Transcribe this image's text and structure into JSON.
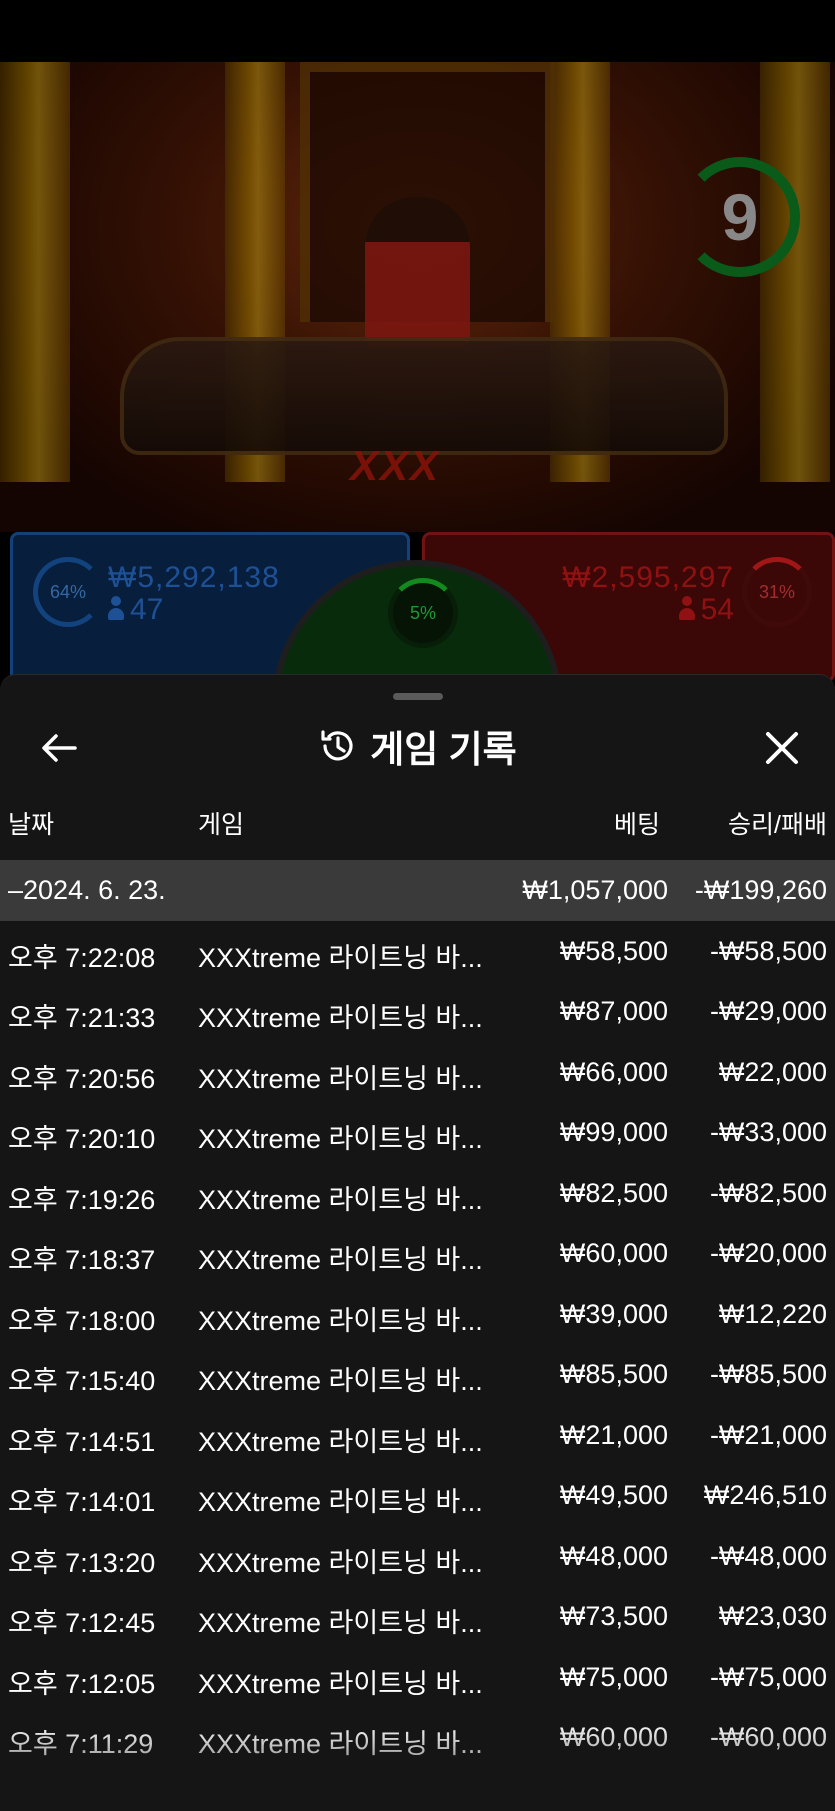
{
  "scene": {
    "timer_value": "9",
    "table_logo": "XXX",
    "player_bet": {
      "percent": "64%",
      "amount": "₩5,292,138",
      "players": "47"
    },
    "banker_bet": {
      "percent": "31%",
      "amount": "₩2,595,297",
      "players": "54"
    },
    "tie_bet": {
      "percent": "5%"
    }
  },
  "colors": {
    "player_blue": "#1e5aa8",
    "banker_red": "#a01a1a",
    "tie_green": "#0c3d10",
    "sheet_bg": "#151515",
    "day_row_bg": "#3a3a3a"
  },
  "history": {
    "title": "게임 기록",
    "icons": {
      "back": "arrow-left-icon",
      "history": "history-clock-icon",
      "close": "close-icon"
    },
    "columns": {
      "date": "날짜",
      "game": "게임",
      "bet": "베팅",
      "result": "승리/패배"
    },
    "day_summary": {
      "date": "–2024. 6. 23.",
      "bet": "₩1,057,000",
      "result": "-₩199,260"
    },
    "rows": [
      {
        "time": "오후 7:22:08",
        "game": "XXXtreme 라이트닝 바...",
        "bet": "₩58,500",
        "result": "-₩58,500"
      },
      {
        "time": "오후 7:21:33",
        "game": "XXXtreme 라이트닝 바...",
        "bet": "₩87,000",
        "result": "-₩29,000"
      },
      {
        "time": "오후 7:20:56",
        "game": "XXXtreme 라이트닝 바...",
        "bet": "₩66,000",
        "result": "₩22,000"
      },
      {
        "time": "오후 7:20:10",
        "game": "XXXtreme 라이트닝 바...",
        "bet": "₩99,000",
        "result": "-₩33,000"
      },
      {
        "time": "오후 7:19:26",
        "game": "XXXtreme 라이트닝 바...",
        "bet": "₩82,500",
        "result": "-₩82,500"
      },
      {
        "time": "오후 7:18:37",
        "game": "XXXtreme 라이트닝 바...",
        "bet": "₩60,000",
        "result": "-₩20,000"
      },
      {
        "time": "오후 7:18:00",
        "game": "XXXtreme 라이트닝 바...",
        "bet": "₩39,000",
        "result": "₩12,220"
      },
      {
        "time": "오후 7:15:40",
        "game": "XXXtreme 라이트닝 바...",
        "bet": "₩85,500",
        "result": "-₩85,500"
      },
      {
        "time": "오후 7:14:51",
        "game": "XXXtreme 라이트닝 바...",
        "bet": "₩21,000",
        "result": "-₩21,000"
      },
      {
        "time": "오후 7:14:01",
        "game": "XXXtreme 라이트닝 바...",
        "bet": "₩49,500",
        "result": "₩246,510"
      },
      {
        "time": "오후 7:13:20",
        "game": "XXXtreme 라이트닝 바...",
        "bet": "₩48,000",
        "result": "-₩48,000"
      },
      {
        "time": "오후 7:12:45",
        "game": "XXXtreme 라이트닝 바...",
        "bet": "₩73,500",
        "result": "₩23,030"
      },
      {
        "time": "오후 7:12:05",
        "game": "XXXtreme 라이트닝 바...",
        "bet": "₩75,000",
        "result": "-₩75,000"
      },
      {
        "time": "오후 7:11:29",
        "game": "XXXtreme 라이트닝 바...",
        "bet": "₩60,000",
        "result": "-₩60,000"
      }
    ]
  }
}
